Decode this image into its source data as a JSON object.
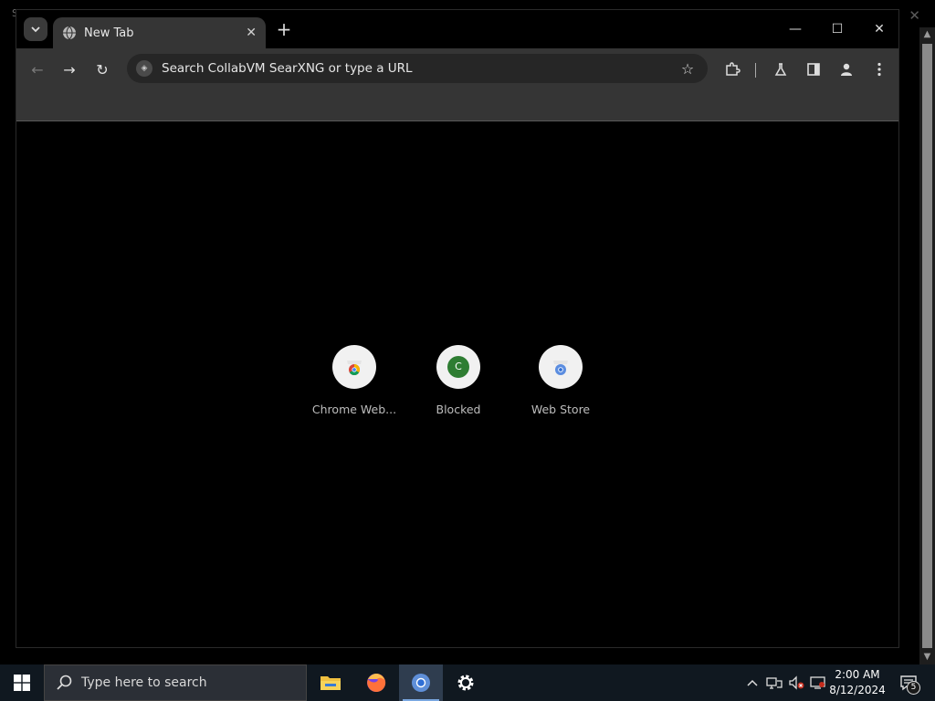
{
  "desktop": {
    "corner_char": "S",
    "close_glyph": "✕"
  },
  "browser": {
    "tab": {
      "title": "New Tab",
      "close_glyph": "✕"
    },
    "new_tab_glyph": "+",
    "window_controls": {
      "minimize": "—",
      "maximize": "☐",
      "close": "✕"
    },
    "toolbar": {
      "back_glyph": "←",
      "forward_glyph": "→",
      "reload_glyph": "↻",
      "omnibox_placeholder": "Search CollabVM SearXNG or type a URL",
      "bookmark_glyph": "☆"
    },
    "shortcuts": [
      {
        "label": "Chrome Web...",
        "icon": "chrome-webstore-icon"
      },
      {
        "label": "Blocked",
        "letter": "C",
        "icon": "letter-avatar-icon",
        "color": "#2e7d32"
      },
      {
        "label": "Web Store",
        "icon": "webstore-icon"
      }
    ]
  },
  "taskbar": {
    "search_placeholder": "Type here to search",
    "apps": [
      "file-explorer-icon",
      "firefox-icon",
      "chrome-icon",
      "settings-icon"
    ],
    "active_app": "chrome-icon",
    "clock": {
      "time": "2:00 AM",
      "date": "8/12/2024"
    },
    "notification_count": "5"
  },
  "colors": {
    "toolbar_bg": "#353535",
    "content_bg": "#000000",
    "taskbar_bg": "#101820",
    "accent": "#7aa7e0"
  }
}
